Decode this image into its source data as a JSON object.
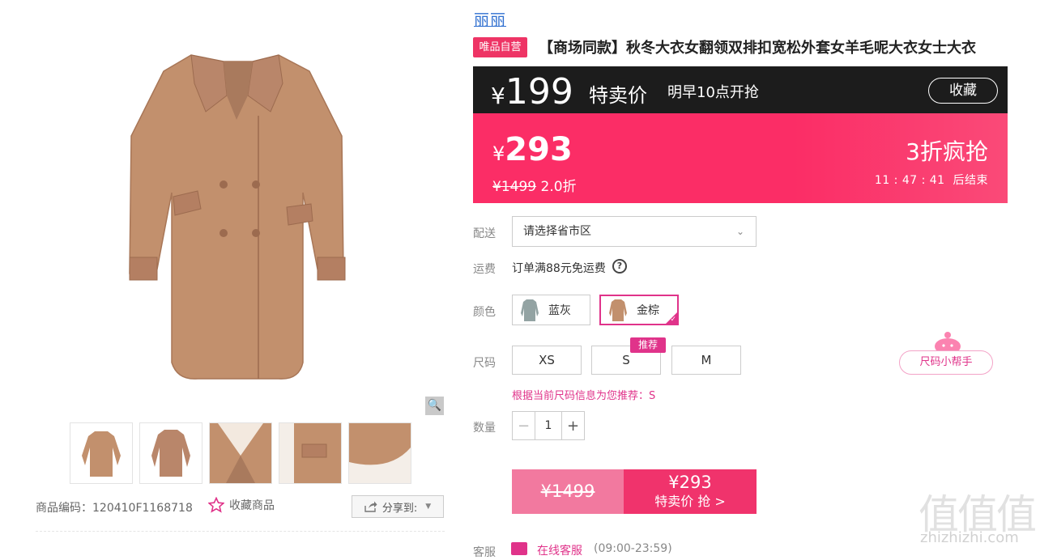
{
  "gallery": {
    "zoom_icon": "magnifier-icon",
    "thumbnails": [
      "front-view",
      "back-view",
      "collar-detail",
      "pocket-detail",
      "hem-detail"
    ]
  },
  "meta": {
    "sku_label": "商品编码：",
    "sku_value": "120410F1168718",
    "favorite_label": "收藏商品",
    "share_label": "分享到:"
  },
  "product": {
    "brand": "丽丽",
    "badge": "唯品自营",
    "title": "【商场同款】秋冬大衣女翻领双排扣宽松外套女羊毛呢大衣女士大衣"
  },
  "flash": {
    "currency": "¥",
    "price": "199",
    "tag": "特卖价",
    "time": "明早10点开抢",
    "favorite_button": "收藏"
  },
  "sale": {
    "currency": "¥",
    "price": "293",
    "original_price": "¥1499",
    "discount": "2.0折",
    "promo_title": "3折疯抢",
    "countdown": "11 : 47 : 41",
    "countdown_suffix": "后结束"
  },
  "delivery": {
    "label": "配送",
    "placeholder": "请选择省市区"
  },
  "shipping": {
    "label": "运费",
    "text": "订单满88元免运费"
  },
  "colors": {
    "label": "颜色",
    "options": [
      "蓝灰",
      "金棕"
    ],
    "selected": "金棕"
  },
  "sizes": {
    "label": "尺码",
    "options": [
      "XS",
      "S",
      "M"
    ],
    "recommend_tag": "推荐",
    "helper": "尺码小帮手",
    "recommend_text": "根据当前尺码信息为您推荐：S"
  },
  "quantity": {
    "label": "数量",
    "value": "1"
  },
  "buy": {
    "original_price": "¥1499",
    "price": "¥293",
    "cta": "特卖价 抢 >"
  },
  "service": {
    "label": "客服",
    "link": "在线客服",
    "hours": "(09:00-23:59)"
  },
  "watermark": {
    "cn": "值值值",
    "en": "zhizhizhi.com"
  },
  "colors_theme": {
    "accent": "#f0336c",
    "pink_box": "#fb2d66",
    "brand_blue": "#2f6fd0",
    "dark_bar": "#1c1c1c"
  }
}
